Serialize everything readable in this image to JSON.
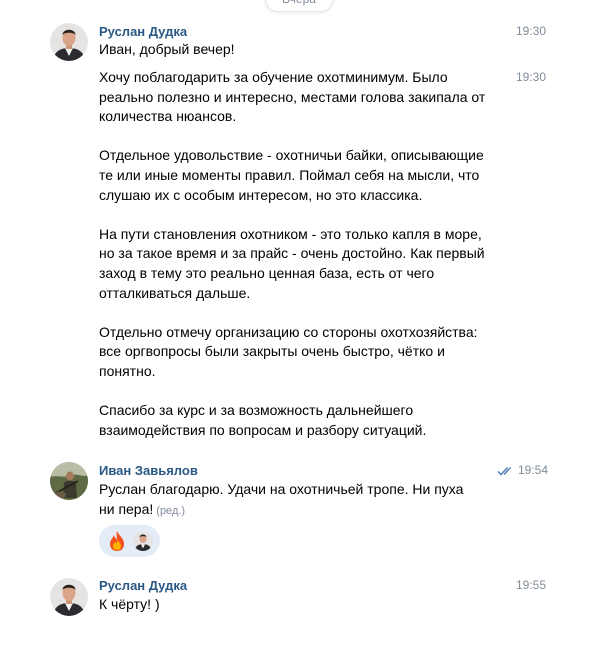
{
  "date_pill": "Вчера",
  "messages": [
    {
      "author": "Руслан Дудка",
      "time": "19:30",
      "text": "Иван, добрый вечер!"
    },
    {
      "time": "19:30",
      "paragraphs": [
        [
          "Хочу поблагодарить за обучение охотминимум. Было",
          "реально полезно и интересно, местами голова закипала от",
          "количества нюансов."
        ],
        [
          "Отдельное удовольствие - охотничьи байки, описывающие",
          "те или иные моменты правил. Поймал себя на мысли, что",
          "слушаю их с особым интересом, но это классика."
        ],
        [
          "На пути становления охотником - это только капля в море,",
          "но за такое время и за прайс - очень достойно. Как первый",
          "заход в тему это реально ценная база, есть от чего",
          "отталкиваться дальше."
        ],
        [
          "Отдельно отмечу организацию со стороны охотхозяйства:",
          "все оргвопросы были закрыты очень быстро, чётко и",
          "понятно."
        ],
        [
          "Спасибо за курс и за возможность дальнейшего",
          "взаимодействия по вопросам и разбору ситуаций."
        ]
      ]
    },
    {
      "author": "Иван Завьялов",
      "time": "19:54",
      "lines": [
        "Руслан благодарю. Удачи на охотничьей тропе. Ни пуха",
        "ни пера!"
      ],
      "edited_label": "(ред.)",
      "reaction_emoji": "🔥"
    },
    {
      "author": "Руслан Дудка",
      "time": "19:55",
      "text": "К чёрту! )"
    }
  ],
  "colors": {
    "author_name": "#2a5885",
    "meta": "#818c99",
    "read_check": "#5181b8",
    "reaction_bg": "#e3ecf7"
  }
}
